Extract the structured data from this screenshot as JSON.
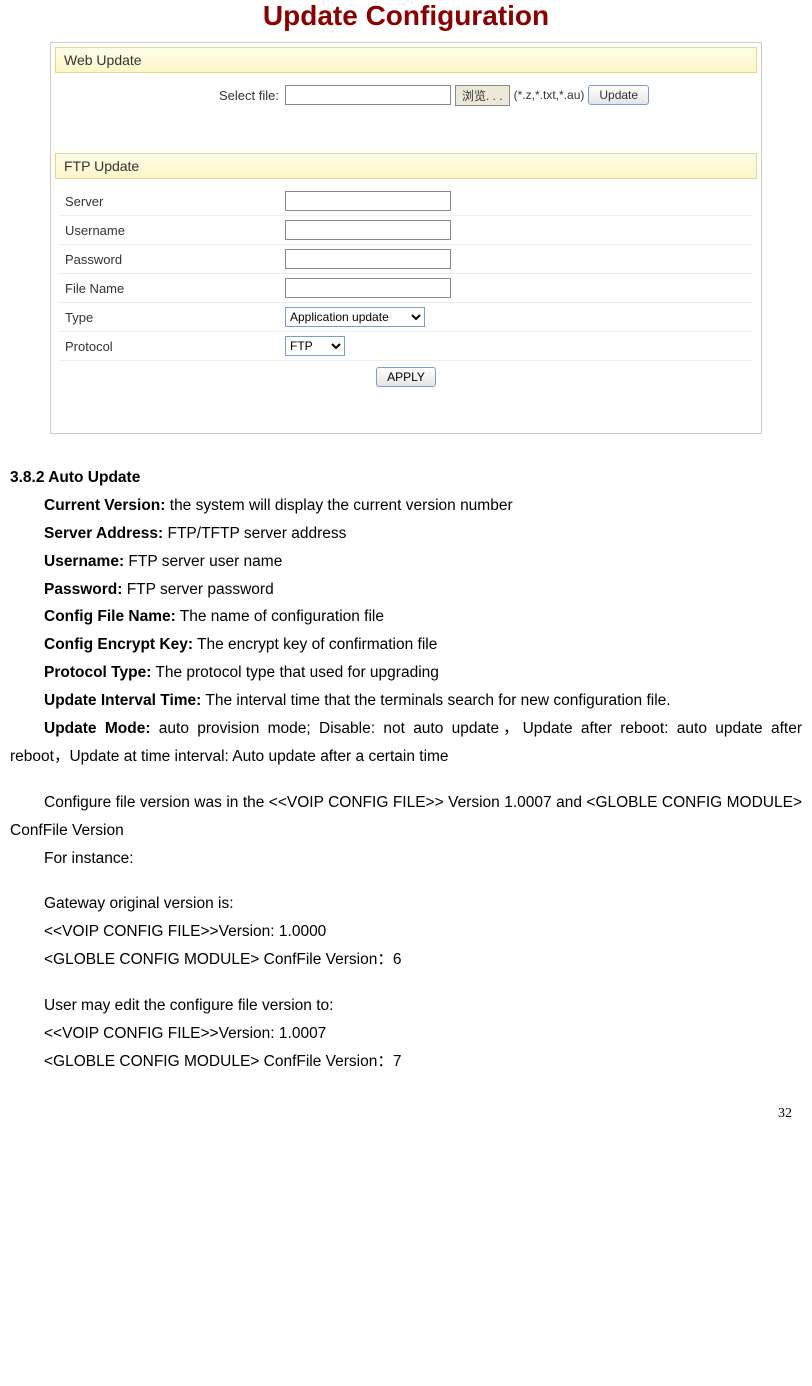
{
  "header": "Update Configuration",
  "web": {
    "section": "Web Update",
    "select_label": "Select file:",
    "browse": "浏览. . .",
    "hint": "(*.z,*.txt,*.au)",
    "update": "Update"
  },
  "ftp": {
    "section": "FTP Update",
    "server": "Server",
    "username": "Username",
    "password": "Password",
    "filename": "File Name",
    "type": "Type",
    "type_value": "Application update",
    "protocol": "Protocol",
    "protocol_value": "FTP",
    "apply": "APPLY"
  },
  "doc": {
    "sec_num": "3.8.2 Auto Update",
    "d1_b": "Current Version:",
    "d1_t": " the system will display the current version number",
    "d2_b": "Server Address:",
    "d2_t": " FTP/TFTP server address",
    "d3_b": "Username:",
    "d3_t": " FTP server user name",
    "d4_b": "Password:",
    "d4_t": " FTP server password",
    "d5_b": "Config File Name:",
    "d5_t": " The name of configuration file",
    "d6_b": "Config Encrypt Key:",
    "d6_t": " The encrypt key of confirmation file",
    "d7_b": "Protocol Type:",
    "d7_t": " The protocol type that used for upgrading",
    "d8_b": "Update Interval Time:",
    "d8_t": " The interval time that the terminals search for new configuration file.",
    "d9_b": "Update Mode:",
    "d9_t": " auto provision mode; Disable: not auto update，Update after reboot: auto update after reboot，Update at time interval: Auto update after a certain time",
    "p1": "Configure file version was in the <<VOIP CONFIG FILE>> Version 1.0007 and <GLOBLE CONFIG MODULE> ConfFile Version",
    "p2": "For instance:",
    "p3": "Gateway original version is:",
    "p4": "<<VOIP CONFIG FILE>>Version: 1.0000",
    "p5": "<GLOBLE CONFIG MODULE>   ConfFile Version：6",
    "p6": "User may edit the configure file version to:",
    "p7": "<<VOIP CONFIG FILE>>Version: 1.0007",
    "p8": "<GLOBLE CONFIG MODULE>   ConfFile Version：7",
    "page": "32"
  }
}
